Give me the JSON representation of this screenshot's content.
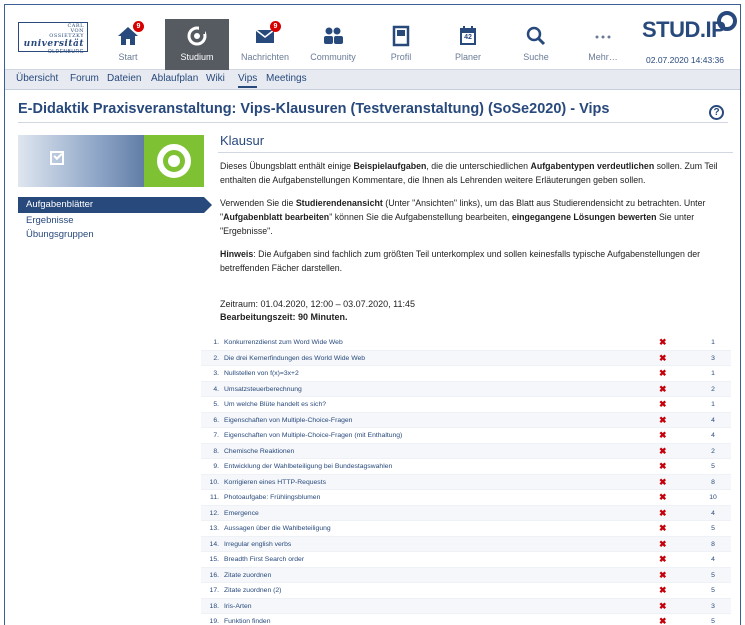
{
  "logo": {
    "line1": "CARL",
    "line2": "VON",
    "line3": "OSSIETZKY",
    "name": "universität",
    "city": "OLDENBURG"
  },
  "nav": [
    {
      "label": "Start",
      "icon": "home-icon",
      "badge": "9"
    },
    {
      "label": "Studium",
      "icon": "studium-icon",
      "badge": ""
    },
    {
      "label": "Nachrichten",
      "icon": "mail-icon",
      "badge": "9"
    },
    {
      "label": "Community",
      "icon": "community-icon",
      "badge": ""
    },
    {
      "label": "Profil",
      "icon": "profile-icon",
      "badge": ""
    },
    {
      "label": "Planer",
      "icon": "calendar-icon",
      "badge": "",
      "calendar_day": "42"
    },
    {
      "label": "Suche",
      "icon": "search-icon",
      "badge": ""
    },
    {
      "label": "Mehr…",
      "icon": "more-icon",
      "badge": ""
    }
  ],
  "brand": "STUD.IP",
  "datetime": "02.07.2020 14:43:36",
  "subnav": [
    "Übersicht",
    "Forum",
    "Dateien",
    "Ablaufplan",
    "Wiki",
    "Vips",
    "Meetings"
  ],
  "active_subnav": "Vips",
  "page_title": "E-Didaktik Praxisveranstaltung: Vips-Klausuren (Testveranstaltung) (SoSe2020) - Vips",
  "help": "?",
  "sidebar": {
    "items": [
      "Aufgabenblätter",
      "Ergebnisse",
      "Übungsgruppen"
    ],
    "active": "Aufgabenblätter"
  },
  "sheet": {
    "title": "Klausur",
    "p1_a": "Dieses Übungsblatt enthält einige ",
    "p1_b": "Beispielaufgaben",
    "p1_c": ", die die unterschiedlichen ",
    "p1_d": "Aufgabentypen verdeutlichen",
    "p1_e": " sollen. Zum Teil enthalten die Aufgabenstellungen Kommentare, die Ihnen als Lehrenden weitere Erläuterungen geben sollen.",
    "p2_a": "Verwenden Sie die ",
    "p2_b": "Studierendenansicht",
    "p2_c": " (Unter \"Ansichten\" links), um das Blatt aus Studierendensicht zu betrachten. Unter \"",
    "p2_d": "Aufgabenblatt bearbeiten",
    "p2_e": "\" können Sie die Aufgabenstellung bearbeiten, ",
    "p2_f": "eingegangene Lösungen bewerten",
    "p2_g": " Sie unter \"Ergebnisse\".",
    "p3_a": "Hinweis",
    "p3_b": ": Die Aufgaben sind fachlich zum größten Teil unterkomplex und sollen keinesfalls typische Aufgabenstellungen der betreffenden Fächer darstellen.",
    "period": "Zeitraum: 01.04.2020, 12:00 – 03.07.2020, 11:45",
    "duration": "Bearbeitungszeit: 90 Minuten."
  },
  "tasks": [
    {
      "num": "1.",
      "name": "Konkurrenzdienst zum Word Wide Web",
      "points": "1"
    },
    {
      "num": "2.",
      "name": "Die drei Kernerfindungen des World Wide Web",
      "points": "3"
    },
    {
      "num": "3.",
      "name": "Nullstellen von f(x)=3x+2",
      "points": "1"
    },
    {
      "num": "4.",
      "name": "Umsatzsteuerberechnung",
      "points": "2"
    },
    {
      "num": "5.",
      "name": "Um welche Blüte handelt es sich?",
      "points": "1"
    },
    {
      "num": "6.",
      "name": "Eigenschaften von Multiple-Choice-Fragen",
      "points": "4"
    },
    {
      "num": "7.",
      "name": "Eigenschaften von Multiple-Choice-Fragen (mit Enthaltung)",
      "points": "4"
    },
    {
      "num": "8.",
      "name": "Chemische Reaktionen",
      "points": "2"
    },
    {
      "num": "9.",
      "name": "Entwicklung der Wahlbeteiligung bei Bundestagswahlen",
      "points": "5"
    },
    {
      "num": "10.",
      "name": "Korrigieren eines HTTP-Requests",
      "points": "8"
    },
    {
      "num": "11.",
      "name": "Photoaufgabe: Frühlingsblumen",
      "points": "10"
    },
    {
      "num": "12.",
      "name": "Emergence",
      "points": "4"
    },
    {
      "num": "13.",
      "name": "Aussagen über die Wahlbeteiligung",
      "points": "5"
    },
    {
      "num": "14.",
      "name": "Irregular english verbs",
      "points": "8"
    },
    {
      "num": "15.",
      "name": "Breadth First Search order",
      "points": "4"
    },
    {
      "num": "16.",
      "name": "Zitate zuordnen",
      "points": "5"
    },
    {
      "num": "17.",
      "name": "Zitate zuordnen (2)",
      "points": "5"
    },
    {
      "num": "18.",
      "name": "Iris-Arten",
      "points": "3"
    },
    {
      "num": "19.",
      "name": "Funktion finden",
      "points": "5"
    }
  ],
  "colors": {
    "primary": "#28497c",
    "vips_green": "#7ec234",
    "status_red": "#c5000b",
    "badge_red": "#d60000"
  }
}
